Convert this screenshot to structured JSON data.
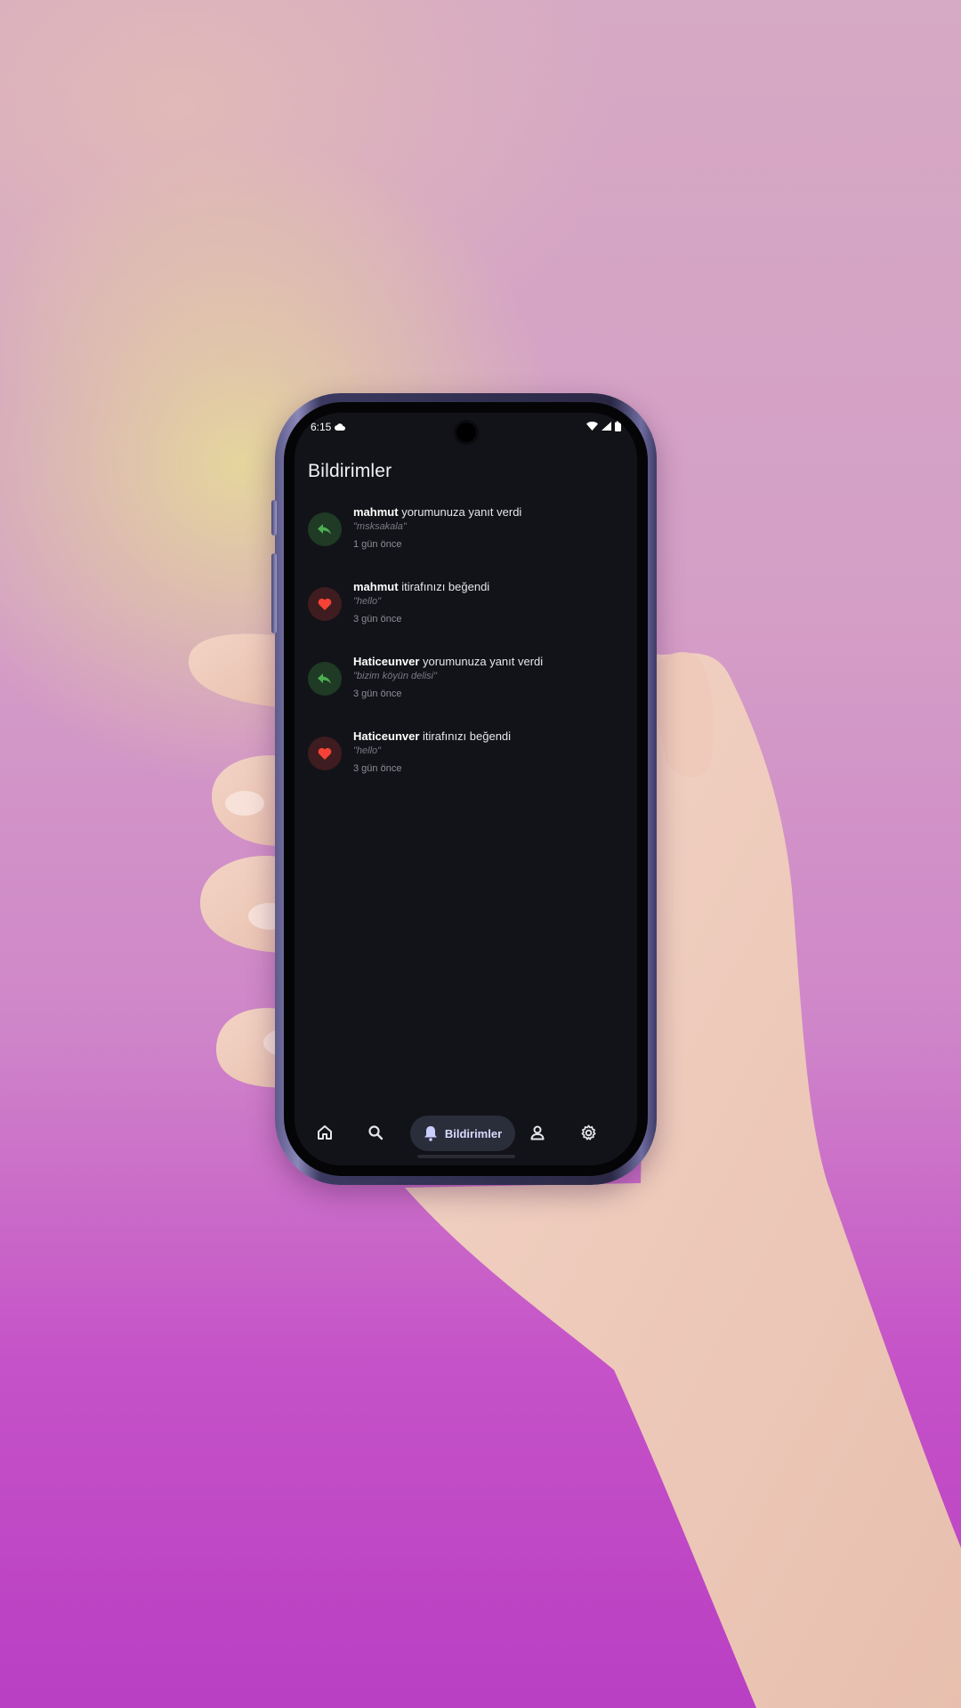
{
  "status_bar": {
    "time": "6:15"
  },
  "header": {
    "title": "Bildirimler"
  },
  "notifications": [
    {
      "type": "reply",
      "icon": "reply-icon",
      "user": "mahmut",
      "action": "yorumunuza yanıt verdi",
      "quote": "\"msksakala\"",
      "time": "1 gün önce"
    },
    {
      "type": "like",
      "icon": "heart-icon",
      "user": "mahmut",
      "action": "itirafınızı beğendi",
      "quote": "\"hello\"",
      "time": "3 gün önce"
    },
    {
      "type": "reply",
      "icon": "reply-icon",
      "user": "Haticeunver",
      "action": "yorumunuza yanıt verdi",
      "quote": "\"bizim köyün delisi\"",
      "time": "3 gün önce"
    },
    {
      "type": "like",
      "icon": "heart-icon",
      "user": "Haticeunver",
      "action": "itirafınızı beğendi",
      "quote": "\"hello\"",
      "time": "3 gün önce"
    }
  ],
  "bottom_nav": {
    "items": [
      "home-icon",
      "search-icon",
      "bell-icon",
      "person-icon",
      "gear-icon"
    ],
    "active_label": "Bildirimler"
  },
  "colors": {
    "screen_bg": "#121318",
    "reply_accent": "#4caf50",
    "like_accent": "#f44336",
    "active_pill": "#2a2d3a"
  }
}
